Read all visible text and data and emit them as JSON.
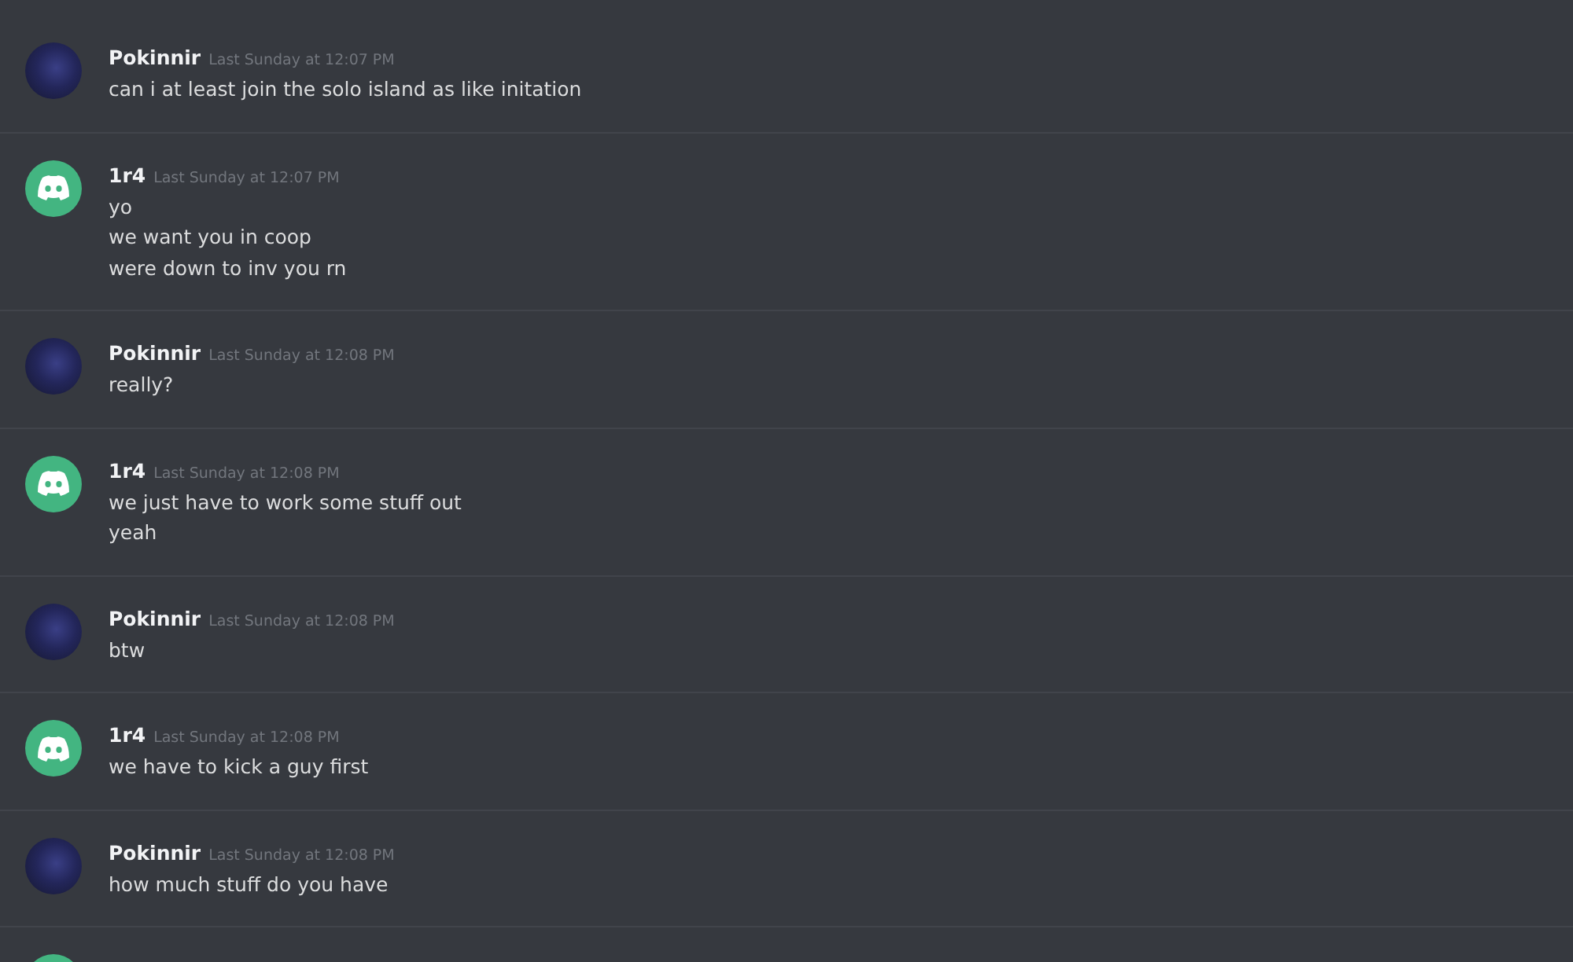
{
  "messages": [
    {
      "kind": "photo",
      "author": "Pokinnir",
      "timestamp": "Last Sunday at 12:07 PM",
      "lines": [
        "can i at least join the solo island as like initation"
      ]
    },
    {
      "kind": "bot",
      "author": "1r4",
      "timestamp": "Last Sunday at 12:07 PM",
      "lines": [
        "yo",
        "we want you in coop",
        "were down to inv you rn"
      ]
    },
    {
      "kind": "photo",
      "author": "Pokinnir",
      "timestamp": "Last Sunday at 12:08 PM",
      "lines": [
        "really?"
      ]
    },
    {
      "kind": "bot",
      "author": "1r4",
      "timestamp": "Last Sunday at 12:08 PM",
      "lines": [
        "we just have to work some stuff out",
        "yeah"
      ]
    },
    {
      "kind": "photo",
      "author": "Pokinnir",
      "timestamp": "Last Sunday at 12:08 PM",
      "lines": [
        "btw"
      ]
    },
    {
      "kind": "bot",
      "author": "1r4",
      "timestamp": "Last Sunday at 12:08 PM",
      "lines": [
        "we have to kick a guy first"
      ]
    },
    {
      "kind": "photo",
      "author": "Pokinnir",
      "timestamp": "Last Sunday at 12:08 PM",
      "lines": [
        "how much stuff do you have"
      ]
    },
    {
      "kind": "bot"
    }
  ]
}
